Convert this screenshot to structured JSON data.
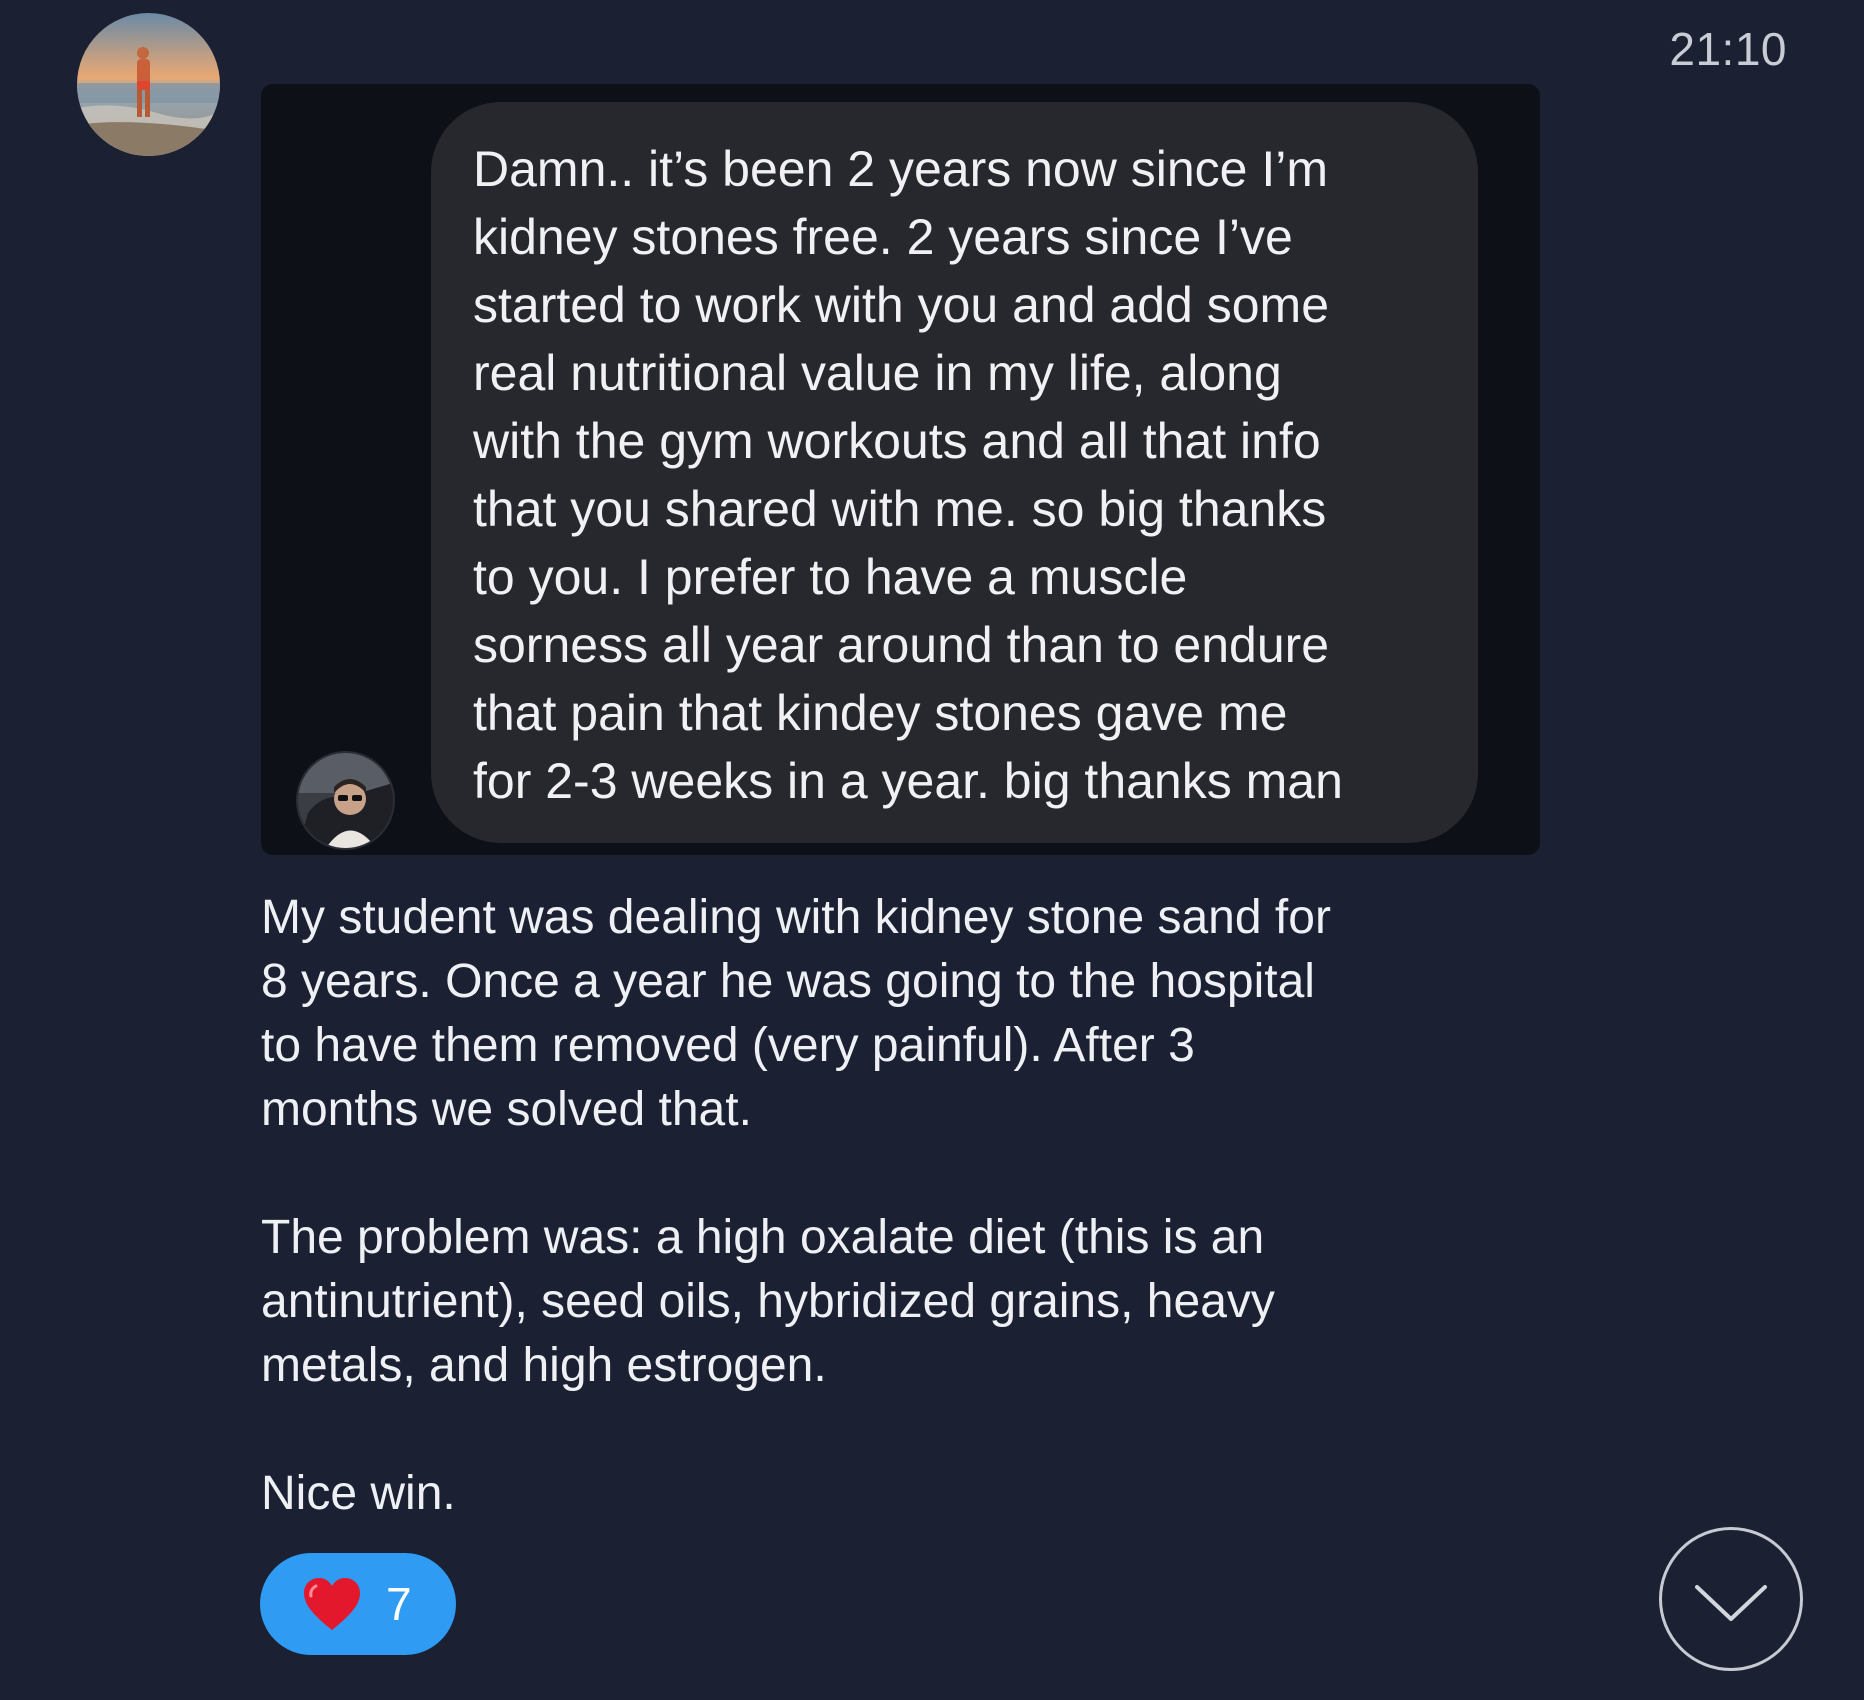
{
  "message": {
    "time": "21:10",
    "sender_avatar": "sender-avatar-photo",
    "quoted_screenshot": {
      "avatar": "friend-avatar-photo",
      "bubble_text": "Damn.. it’s been 2 years now since I’m\nkidney stones free. 2 years since I’ve\nstarted to work with you and add some\nreal nutritional value in my life, along\nwith the gym workouts and all that info\nthat you shared with me. so big thanks\nto you. I prefer to have a muscle\nsorness all year around than to endure\nthat pain that kindey stones gave me\nfor 2-3 weeks in a year. big thanks man"
    },
    "paragraphs": [
      "My student was dealing with kidney stone sand for\n8 years. Once a year he was going to the hospital\nto have them removed (very painful). After 3\nmonths we solved that.",
      "The problem was: a high oxalate diet (this is an\nantinutrient), seed oils, hybridized grains, heavy\nmetals, and high estrogen.",
      "Nice win."
    ],
    "reaction": {
      "icon": "heart-icon",
      "count": "7",
      "color": "#2f9bf2"
    }
  },
  "controls": {
    "scroll_down_icon": "chevron-down-icon"
  },
  "colors": {
    "background": "#1b2032",
    "card": "#0d1017",
    "bubble": "#27282d",
    "text": "#eef0f4"
  }
}
